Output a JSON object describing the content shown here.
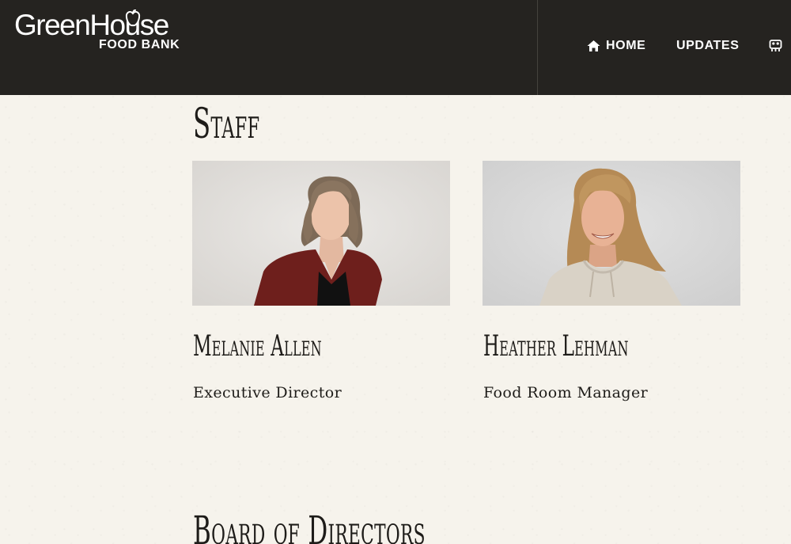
{
  "brand": {
    "name": "GreenHouse",
    "sub": "FOOD BANK"
  },
  "nav": {
    "items": [
      {
        "label": "HOME",
        "icon": "home-icon"
      },
      {
        "label": "UPDATES"
      },
      {
        "label": "",
        "icon": "people-icon"
      }
    ]
  },
  "staff": {
    "heading": "Staff",
    "members": [
      {
        "name": "Melanie Allen",
        "role": "Executive Director",
        "photo": "photo-portrait"
      },
      {
        "name": "Heather Lehman",
        "role": "Food Room Manager",
        "photo": "photo-portrait"
      }
    ]
  },
  "board": {
    "heading": "Board of Directors"
  },
  "colors": {
    "header_bg": "#252320",
    "page_bg": "#f6f3ec",
    "text": "#1e1c19",
    "nav_text": "#ffffff"
  }
}
